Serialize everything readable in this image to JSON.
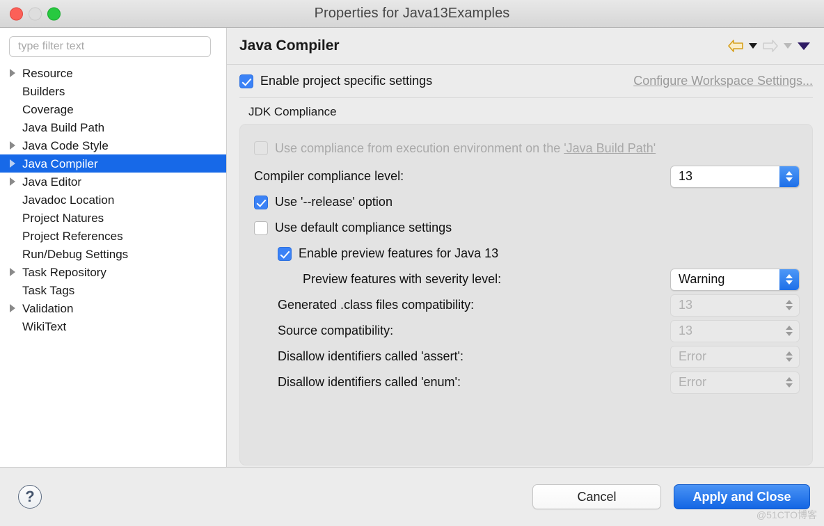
{
  "window": {
    "title": "Properties for Java13Examples",
    "controls": {
      "close": "close",
      "minimize": "minimize",
      "maximize": "maximize"
    }
  },
  "sidebar": {
    "filter": {
      "placeholder": "type filter text",
      "value": ""
    },
    "items": [
      {
        "label": "Resource",
        "expandable": true,
        "selected": false
      },
      {
        "label": "Builders",
        "expandable": false,
        "selected": false
      },
      {
        "label": "Coverage",
        "expandable": false,
        "selected": false
      },
      {
        "label": "Java Build Path",
        "expandable": false,
        "selected": false
      },
      {
        "label": "Java Code Style",
        "expandable": true,
        "selected": false
      },
      {
        "label": "Java Compiler",
        "expandable": true,
        "selected": true
      },
      {
        "label": "Java Editor",
        "expandable": true,
        "selected": false
      },
      {
        "label": "Javadoc Location",
        "expandable": false,
        "selected": false
      },
      {
        "label": "Project Natures",
        "expandable": false,
        "selected": false
      },
      {
        "label": "Project References",
        "expandable": false,
        "selected": false
      },
      {
        "label": "Run/Debug Settings",
        "expandable": false,
        "selected": false
      },
      {
        "label": "Task Repository",
        "expandable": true,
        "selected": false
      },
      {
        "label": "Task Tags",
        "expandable": false,
        "selected": false
      },
      {
        "label": "Validation",
        "expandable": true,
        "selected": false
      },
      {
        "label": "WikiText",
        "expandable": false,
        "selected": false
      }
    ]
  },
  "page": {
    "title": "Java Compiler",
    "nav": {
      "back": "back-arrow",
      "back_menu": "back-dropdown",
      "forward": "forward-arrow",
      "forward_menu": "forward-dropdown",
      "menu": "view-menu"
    },
    "enable_project_specific": {
      "label": "Enable project specific settings",
      "checked": true
    },
    "workspace_link": "Configure Workspace Settings...",
    "group": {
      "title": "JDK Compliance",
      "use_execution_env": {
        "label_prefix": "Use compliance from execution environment on the ",
        "link": "'Java Build Path'",
        "checked": false,
        "enabled": false
      },
      "rows": [
        {
          "label": "Compiler compliance level:",
          "indent": "none",
          "control": "combo",
          "value": "13",
          "enabled": true
        },
        {
          "label": "Use '--release' option",
          "indent": "none",
          "control": "checkbox",
          "checked": true,
          "enabled": true
        },
        {
          "label": "Use default compliance settings",
          "indent": "none",
          "control": "checkbox",
          "checked": false,
          "enabled": true
        },
        {
          "label": "Enable preview features for Java 13",
          "indent": "level1",
          "control": "checkbox",
          "checked": true,
          "enabled": true
        },
        {
          "label": "Preview features with severity level:",
          "indent": "level2",
          "control": "combo",
          "value": "Warning",
          "enabled": true
        },
        {
          "label": "Generated .class files compatibility:",
          "indent": "level1",
          "control": "combo",
          "value": "13",
          "enabled": false
        },
        {
          "label": "Source compatibility:",
          "indent": "level1",
          "control": "combo",
          "value": "13",
          "enabled": false
        },
        {
          "label": "Disallow identifiers called 'assert':",
          "indent": "level1",
          "control": "combo",
          "value": "Error",
          "enabled": false
        },
        {
          "label": "Disallow identifiers called 'enum':",
          "indent": "level1",
          "control": "combo",
          "value": "Error",
          "enabled": false
        }
      ]
    }
  },
  "footer": {
    "help": "?",
    "cancel": "Cancel",
    "apply": "Apply and Close"
  },
  "watermark": "@51CTO博客",
  "colors": {
    "selection_blue": "#1769e8",
    "checkbox_blue": "#3b82f6",
    "primary_button": "#1366e4",
    "back_arrow": "#e0a01b",
    "menu_caret": "#2e1a63"
  }
}
